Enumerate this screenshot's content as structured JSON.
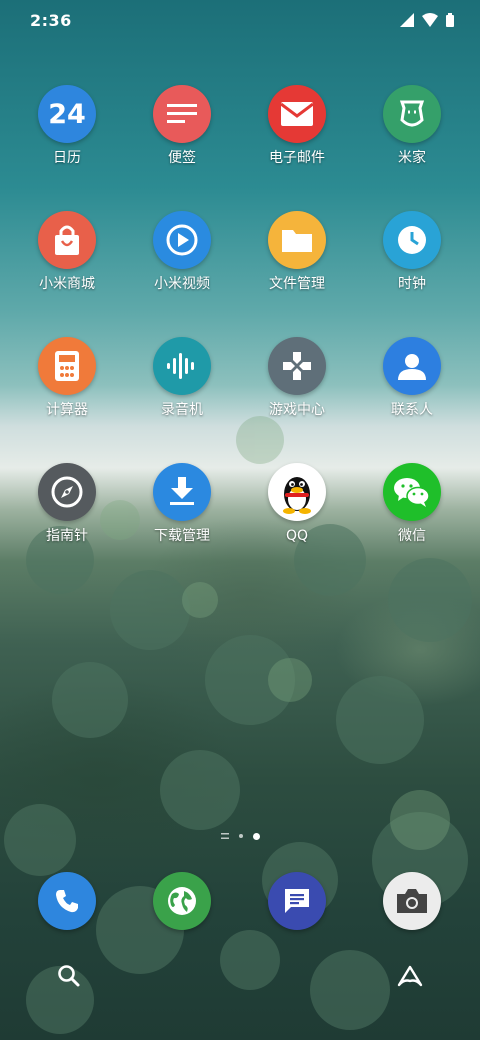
{
  "status_bar": {
    "time": "2:36"
  },
  "apps": [
    {
      "label": "日历",
      "icon": "calendar-icon",
      "color": "#2e86de",
      "calendar_day": "24"
    },
    {
      "label": "便签",
      "icon": "notes-icon",
      "color": "#e85a5a"
    },
    {
      "label": "电子邮件",
      "icon": "mail-icon",
      "color": "#e53935"
    },
    {
      "label": "米家",
      "icon": "mijia-icon",
      "color": "#35a06a"
    },
    {
      "label": "小米商城",
      "icon": "shopping-bag-icon",
      "color": "#e8604a"
    },
    {
      "label": "小米视频",
      "icon": "play-icon",
      "color": "#2a8be0"
    },
    {
      "label": "文件管理",
      "icon": "folder-icon",
      "color": "#f5b43b"
    },
    {
      "label": "时钟",
      "icon": "clock-icon",
      "color": "#29a3d6"
    },
    {
      "label": "计算器",
      "icon": "calculator-icon",
      "color": "#f07a3a"
    },
    {
      "label": "录音机",
      "icon": "soundwave-icon",
      "color": "#1f9aa8"
    },
    {
      "label": "游戏中心",
      "icon": "gamepad-icon",
      "color": "#5f6f79"
    },
    {
      "label": "联系人",
      "icon": "contact-icon",
      "color": "#2d7fe0"
    },
    {
      "label": "指南针",
      "icon": "compass-icon",
      "color": "#555a5e"
    },
    {
      "label": "下载管理",
      "icon": "download-icon",
      "color": "#2b89e0"
    },
    {
      "label": "QQ",
      "icon": "qq-penguin-icon",
      "color": "#ffffff"
    },
    {
      "label": "微信",
      "icon": "wechat-icon",
      "color": "#1fbf2a"
    }
  ],
  "dock": [
    {
      "icon": "phone-icon",
      "color": "#2e86de"
    },
    {
      "icon": "browser-globe-icon",
      "color": "#3aa24a"
    },
    {
      "icon": "messages-icon",
      "color": "#3a4bb0"
    },
    {
      "icon": "camera-icon",
      "color": "#ececec"
    }
  ]
}
